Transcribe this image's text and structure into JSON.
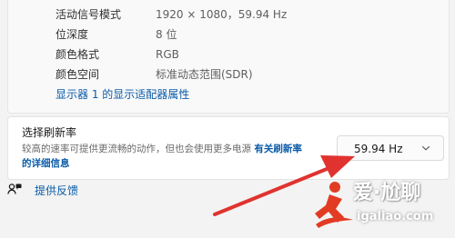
{
  "display_properties": {
    "rows": [
      {
        "label": "活动信号模式",
        "value": "1920 × 1080，59.94 Hz"
      },
      {
        "label": "位深度",
        "value": "8 位"
      },
      {
        "label": "颜色格式",
        "value": "RGB"
      },
      {
        "label": "颜色空间",
        "value": "标准动态范围(SDR)"
      }
    ],
    "adapter_link": "显示器 1 的显示适配器属性"
  },
  "refresh_rate": {
    "title": "选择刷新率",
    "description": "较高的速率可提供更流畅的动作，但也会使用更多电源",
    "description_link_1": "有关刷新率",
    "description_link_2": "的详细信息",
    "selected": "59.94 Hz"
  },
  "feedback": {
    "label": "提供反馈",
    "icon": "feedback-icon"
  },
  "watermark": {
    "title": "爱·尬聊",
    "url": "igaliao.com"
  },
  "colors": {
    "link": "#0a5ba8",
    "arrow": "#e0332f",
    "watermark_red": "#e23b24"
  }
}
